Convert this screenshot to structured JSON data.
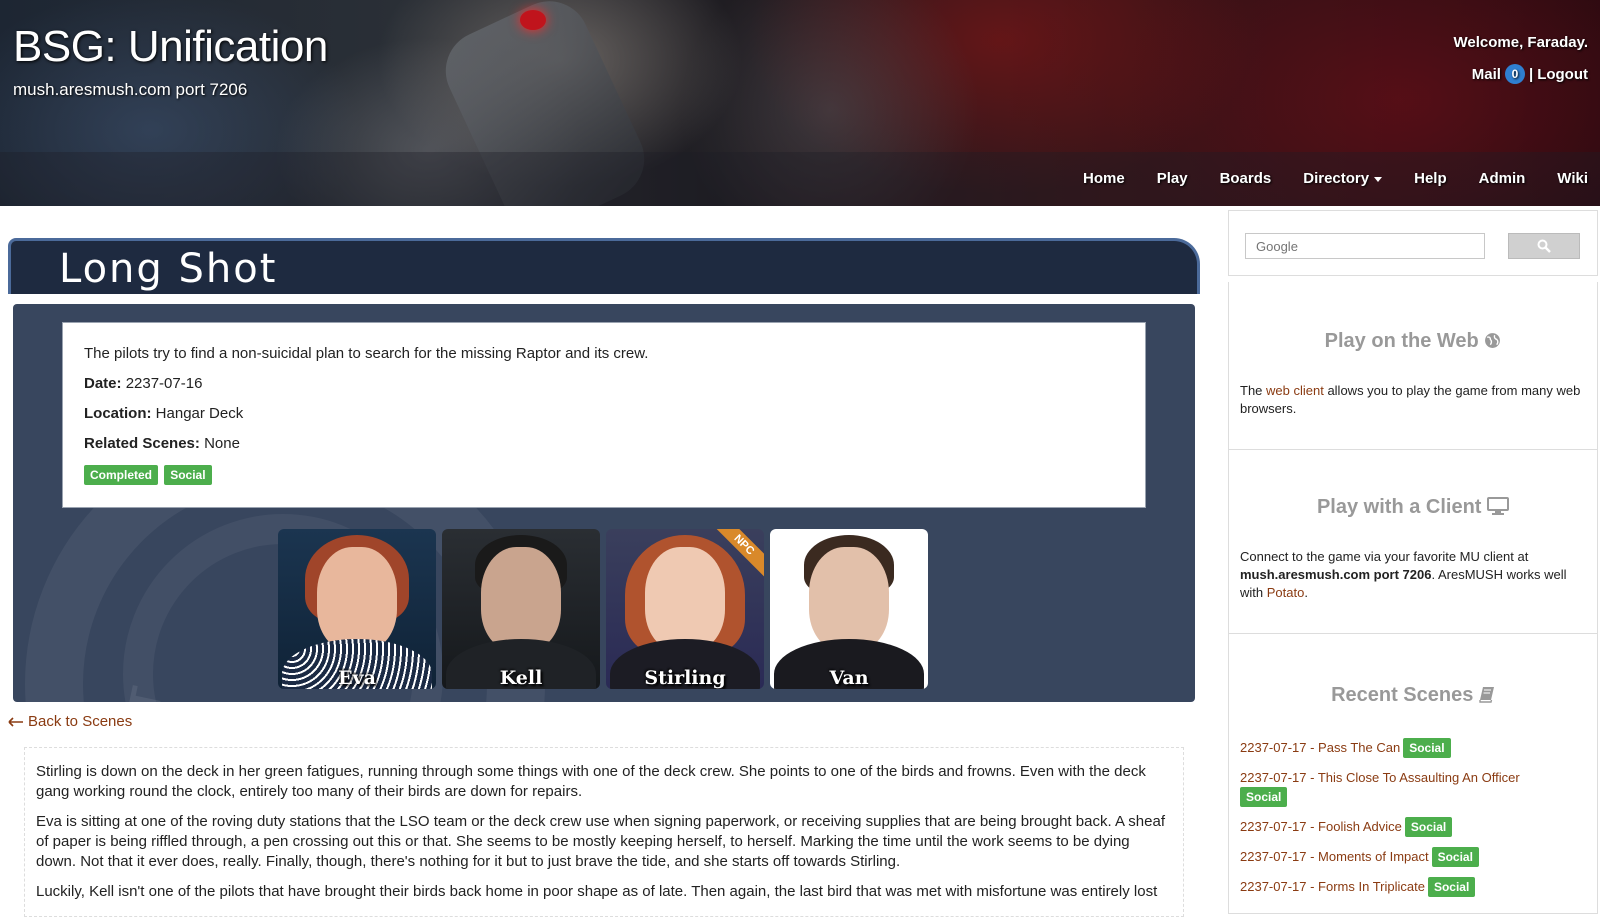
{
  "header": {
    "site_title": "BSG: Unification",
    "site_subtitle": "mush.aresmush.com port 7206",
    "welcome": "Welcome, Faraday.",
    "mail_label": "Mail",
    "mail_count": "0",
    "separator": "|",
    "logout_label": "Logout"
  },
  "nav": {
    "items": [
      "Home",
      "Play",
      "Boards",
      "Directory",
      "Help",
      "Admin",
      "Wiki"
    ]
  },
  "scene": {
    "title": "Long Shot",
    "summary": "The pilots try to find a non-suicidal plan to search for the missing Raptor and its crew.",
    "date_label": "Date:",
    "date": "2237-07-16",
    "location_label": "Location:",
    "location": "Hangar Deck",
    "related_label": "Related Scenes:",
    "related": "None",
    "tags": [
      "Completed",
      "Social"
    ],
    "participants": [
      {
        "name": "Eva",
        "npc": false
      },
      {
        "name": "Kell",
        "npc": false
      },
      {
        "name": "Stirling",
        "npc": true,
        "npc_label": "NPC"
      },
      {
        "name": "Van",
        "npc": false
      }
    ],
    "panel_logo_text": "BATT",
    "back_label": "Back to Scenes",
    "log": [
      "Stirling is down on the deck in her green fatigues, running through some things with one of the deck crew. She points to one of the birds and frowns. Even with the deck gang working round the clock, entirely too many of their birds are down for repairs.",
      "Eva is sitting at one of the roving duty stations that the LSO team or the deck crew use when signing paperwork, or receiving supplies that are being brought back. A sheaf of paper is being riffled through, a pen crossing out this or that. She seems to be mostly keeping herself, to herself. Marking the time until the work seems to be dying down. Not that it ever does, really. Finally, though, there's nothing for it but to just brave the tide, and she starts off towards Stirling.",
      "Luckily, Kell isn't one of the pilots that have brought their birds back home in poor shape as of late. Then again, the last bird that was met with misfortune was entirely lost"
    ]
  },
  "sidebar": {
    "search_placeholder": "Google",
    "web": {
      "title": "Play on the Web",
      "text_before": "The ",
      "link": "web client",
      "text_after": " allows you to play the game from many web browsers."
    },
    "client": {
      "title": "Play with a Client",
      "text_before": "Connect to the game via your favorite MU client at ",
      "bold": "mush.aresmush.com port 7206",
      "text_middle": ". AresMUSH works well with ",
      "link": "Potato",
      "text_after": "."
    },
    "recent": {
      "title": "Recent Scenes",
      "items": [
        {
          "text": "2237-07-17 - Pass The Can",
          "tag": "Social"
        },
        {
          "text": "2237-07-17 - This Close To Assaulting An Officer",
          "tag": "Social"
        },
        {
          "text": "2237-07-17 - Foolish Advice",
          "tag": "Social"
        },
        {
          "text": "2237-07-17 - Moments of Impact",
          "tag": "Social"
        },
        {
          "text": "2237-07-17 - Forms In Triplicate",
          "tag": "Social"
        }
      ]
    }
  },
  "colors": {
    "link": "#8a3b12",
    "label_success": "#4cae4c",
    "title_bar": "#1e2a40",
    "panel": "#38465e",
    "badge": "#2f7fd0"
  },
  "icons": {
    "globe": "globe-icon",
    "monitor": "monitor-icon",
    "book": "book-icon",
    "search": "search-icon",
    "back_arrow": "arrow-left-icon",
    "dropdown": "caret-down-icon"
  }
}
